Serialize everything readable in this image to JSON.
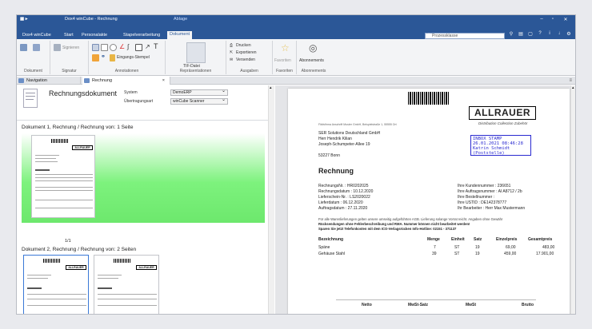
{
  "titlebar": {
    "app_title": "Dox4 winCube - Rechnung",
    "context_tab": "Ablage",
    "controls": [
      "–",
      "▫",
      "✕"
    ]
  },
  "tabs": [
    "Dox4 winCube",
    "Start",
    "Personalakte",
    "Stapelverarbeitung",
    "Dokument"
  ],
  "search": {
    "placeholder": "Prozessklasse"
  },
  "ribbon": {
    "groups": [
      "Dokument",
      "Signatur",
      "Annotationen",
      "Repräsentationen",
      "Ausgaben",
      "Favoriten",
      "Abonnements"
    ],
    "signieren": "Signieren",
    "stempel": "Eingangs-Stempel",
    "tiff": "TIF-Datei",
    "drucken": "Drucken",
    "exportieren": "Exportieren",
    "versenden": "Versenden",
    "favoriten": "Favoriten",
    "abonnements": "Abonnements"
  },
  "doctabs": {
    "navigation": "Navigation",
    "rechnung": "Rechnung"
  },
  "info": {
    "title": "Rechnungsdokument",
    "system_label": "System",
    "system_value": "DemoERP",
    "uebertragung_label": "Übertragungsart",
    "uebertragung_value": "winCube Scanner"
  },
  "doc1": {
    "header": "Dokument 1, Rechnung / Rechnung  von: 1 Seite",
    "page": "1/1"
  },
  "doc2": {
    "header": "Dokument 2, Rechnung / Rechnung  von: 2 Seiten"
  },
  "invoice": {
    "logo": "ALLRAUER",
    "logo_sub": "Distribution Collection Zubehör",
    "sender_line": "Fiktivfirma Anschrift Muster GmbH, Beispielstraße 1, 55555 Ort",
    "address": [
      "SER Solutions Deutschland GmbH",
      "Herr Hendrik Kilian",
      "Joseph-Schumpeter-Allee 19",
      "",
      "53227 Bonn"
    ],
    "stamp": [
      "INBOX STAMP",
      "26.01.2021 08:46:28",
      "Katrin Schmidt",
      "(Poststelle)"
    ],
    "heading": "Rechnung",
    "left_meta": [
      "RechnungsNr. : HR0202025",
      "Rechnungsdatum : 10.12.2020",
      "Lieferschein-Nr. : LS2020022",
      "Lieferdatum : 06.12.2020",
      "Auftragsdatum : 27.11.2020"
    ],
    "right_meta": [
      "Ihre Kundennummer : 236651",
      "Ihre Auftragsnummer : AI A8712 / 2b",
      "Ihre Bestellnummer :",
      "Ihre USTID : DE142378777",
      "Ihr Bearbeiter : Herr Max Mustermann"
    ],
    "notice": [
      "Für alle Warenlieferungen gelten unsere umseitig aufgeführten AGB. Lieferung solange Vorrat reicht. Angaben ohne Gewähr",
      "Rücksendungen ohne Fehlerbeschreibung und RMA. Nummer können nicht bearbeitet werden!",
      "Sparen Sie jetzt Telefonkosten mit dem ICO-Verlagsrücken Info-Hotline: 02151 - 371137"
    ],
    "table_headers": [
      "Bezeichnung",
      "Menge",
      "Einheit",
      "Satz",
      "Einzelpreis",
      "Gesamtpreis"
    ],
    "rows": [
      [
        "Späne",
        "7",
        "ST",
        "19",
        "69,00",
        "483,00"
      ],
      [
        "Gehäuse Stahl",
        "39",
        "ST",
        "19",
        "459,00",
        "17.901,00"
      ]
    ],
    "footer_headers": [
      "Netto",
      "MwSt-Satz",
      "MwSt",
      "Brutto"
    ]
  }
}
